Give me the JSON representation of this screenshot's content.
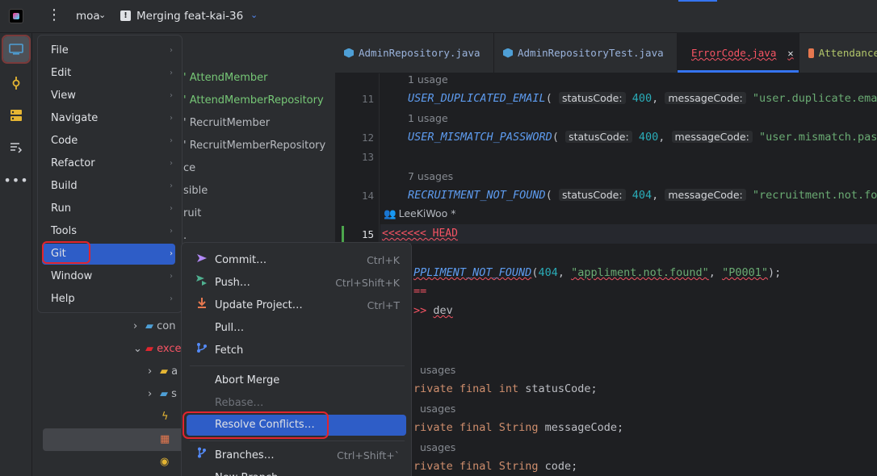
{
  "topbar": {
    "project": "moa",
    "branch": "Merging feat-kai-36",
    "merge_icon": "!",
    "kebab": "⋮",
    "chevron": "⌄"
  },
  "tool_icons": [
    "project-icon",
    "commit-icon",
    "structure-icon",
    "pull-requests-icon",
    "more-icon"
  ],
  "project_tree": {
    "rows": [
      "' AttendMember",
      "' AttendMemberRepository",
      "' RecruitMember",
      "' RecruitMemberRepository",
      "ce",
      "sible",
      "ruit",
      ".",
      "con",
      "exce",
      "a",
      "s",
      "ı",
      "",
      "e"
    ]
  },
  "tabs": [
    {
      "label": "AdminRepository.java",
      "icon": "java-class-icon"
    },
    {
      "label": "AdminRepositoryTest.java",
      "icon": "java-class-icon"
    },
    {
      "label": "ErrorCode.java",
      "icon": "enum-icon",
      "close": "✕"
    },
    {
      "label": "Attendance",
      "icon": "enum-icon"
    }
  ],
  "editor": {
    "line_numbers": [
      "11",
      "12",
      "13",
      "14",
      "15"
    ],
    "usage_1": "1 usage",
    "usage_2": "1 usage",
    "usage_7": "7 usages",
    "line11": {
      "name": "USER_DUPLICATED_EMAIL",
      "hint1": "statusCode:",
      "num": "400",
      "hint2": "messageCode:",
      "str": "\"user.duplicate.ema"
    },
    "line12": {
      "name": "USER_MISMATCH_PASSWORD",
      "hint1": "statusCode:",
      "num": "400",
      "hint2": "messageCode:",
      "str": "\"user.mismatch.pas"
    },
    "line14": {
      "name": "RECRUITMENT_NOT_FOUND",
      "hint1": "statusCode:",
      "num": "404",
      "hint2": "messageCode:",
      "str": "\"recruitment.not.fo"
    },
    "author": "LeeKiWoo *",
    "conflict_head": "<<<<<<< HEAD",
    "appliment_name": "PPLIMENT_NOT_FOUND",
    "appliment_args_num": "404",
    "appliment_str1": "\"appliment.not.found\"",
    "appliment_str2": "\"P0001\"",
    "sep": "==",
    "conflict_dev_marker": ">>",
    "conflict_dev": "dev",
    "usages_a": "usages",
    "field1_kw": "rivate final",
    "field1_type": "int",
    "field1_name": "statusCode;",
    "usages_b": "usages",
    "field2_kw": "rivate final",
    "field2_type": "String",
    "field2_name": "messageCode;",
    "usages_c": "usages",
    "field3_kw": "rivate final",
    "field3_type": "String",
    "field3_name": "code;"
  },
  "main_menu": {
    "items": [
      "File",
      "Edit",
      "View",
      "Navigate",
      "Code",
      "Refactor",
      "Build",
      "Run",
      "Tools",
      "Git",
      "Window",
      "Help"
    ],
    "arrow": "›"
  },
  "git_menu": {
    "commit": {
      "label": "Commit…",
      "shortcut": "Ctrl+K"
    },
    "push": {
      "label": "Push…",
      "shortcut": "Ctrl+Shift+K"
    },
    "update": {
      "label": "Update Project…",
      "shortcut": "Ctrl+T"
    },
    "pull": {
      "label": "Pull…"
    },
    "fetch": {
      "label": "Fetch"
    },
    "abort": {
      "label": "Abort Merge"
    },
    "rebase": {
      "label": "Rebase…"
    },
    "resolve": {
      "label": "Resolve Conflicts…"
    },
    "branches": {
      "label": "Branches…",
      "shortcut": "Ctrl+Shift+`"
    },
    "new_branch": {
      "label": "New Branch…"
    }
  },
  "colors": {
    "accent": "#2e5dc7",
    "highlight_box": "#e1252e",
    "background": "#1e1f22",
    "panel": "#2b2d30"
  }
}
